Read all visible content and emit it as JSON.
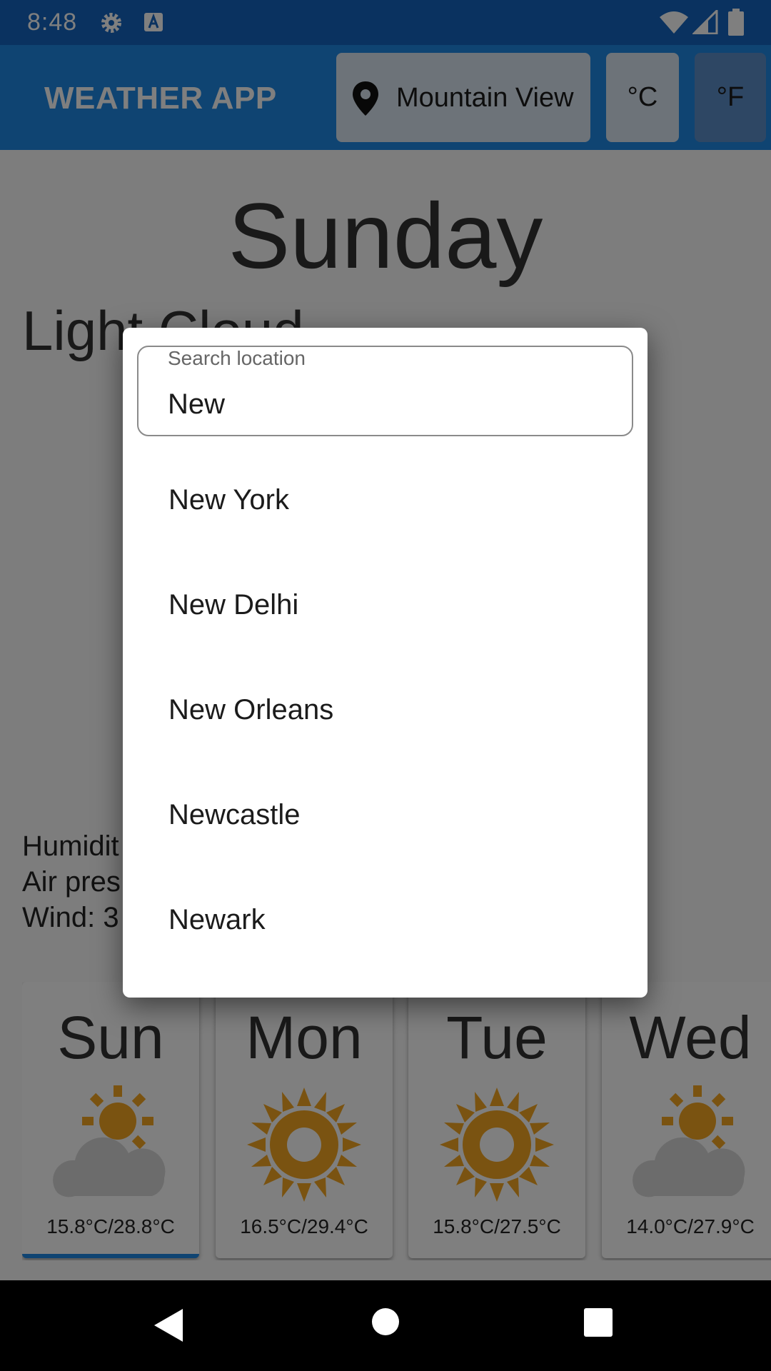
{
  "status_bar": {
    "time": "8:48",
    "icons": [
      "gear-icon",
      "a-box-icon",
      "wifi-icon",
      "signal-icon",
      "battery-icon"
    ]
  },
  "app_bar": {
    "title": "WEATHER APP",
    "location_label": "Mountain View",
    "unit_celsius": "°C",
    "unit_fahrenheit": "°F",
    "selected_unit": "°C",
    "icons": [
      "location-pin-icon"
    ]
  },
  "today": {
    "day_name": "Sunday",
    "condition": "Light Cloud",
    "humidity_label": "Humidit",
    "pressure_label": "Air pres",
    "wind_label": "Wind: 3"
  },
  "forecast": [
    {
      "day": "Sun",
      "icon": "partly-cloudy-icon",
      "temp": "15.8°C/28.8°C",
      "selected": true
    },
    {
      "day": "Mon",
      "icon": "sun-icon",
      "temp": "16.5°C/29.4°C",
      "selected": false
    },
    {
      "day": "Tue",
      "icon": "sun-icon",
      "temp": "15.8°C/27.5°C",
      "selected": false
    },
    {
      "day": "Wed",
      "icon": "partly-cloudy-icon",
      "temp": "14.0°C/27.9°C",
      "selected": false
    }
  ],
  "dialog": {
    "search_label": "Search location",
    "search_value": "New",
    "suggestions": [
      "New York",
      "New Delhi",
      "New Orleans",
      "Newcastle",
      "Newark"
    ]
  },
  "nav_bar": {
    "icons": [
      "back-icon",
      "home-icon",
      "recents-icon"
    ]
  },
  "colors": {
    "primary": "#1e88e5",
    "status_bar": "#1565c0",
    "sun": "#f5a623",
    "cloud": "#d9d9d9"
  }
}
